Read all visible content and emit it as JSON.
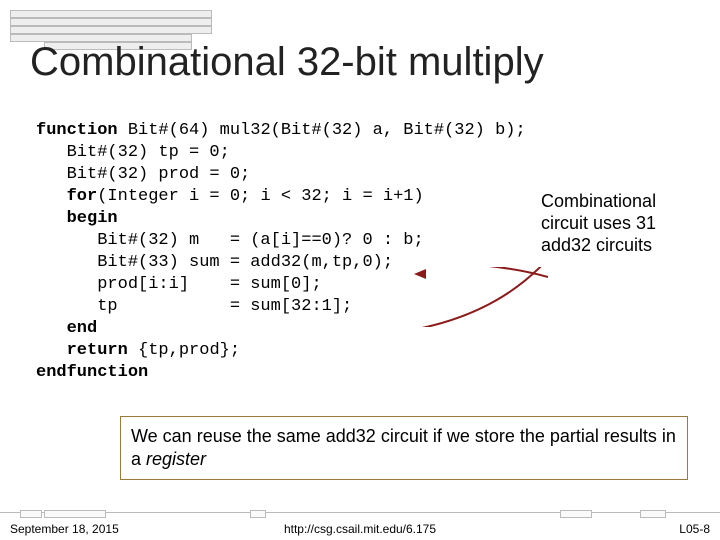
{
  "title": "Combinational 32-bit multiply",
  "code": {
    "l1a": "function",
    "l1b": " Bit#(64) mul32(Bit#(32) a, Bit#(32) b);",
    "l2": "   Bit#(32) tp = 0;",
    "l3": "   Bit#(32) prod = 0;",
    "l4a": "   ",
    "l4b": "for",
    "l4c": "(Integer i = 0; i < 32; i = i+1)",
    "l5": "   begin",
    "l6": "      Bit#(32) m   = (a[i]==0)? 0 : b;",
    "l7": "      Bit#(33) sum = add32(m,tp,0);",
    "l8": "      prod[i:i]    = sum[0];",
    "l9": "      tp           = sum[32:1];",
    "l10": "   end",
    "l11a": "   ",
    "l11b": "return",
    "l11c": " {tp,prod};",
    "l12": "endfunction"
  },
  "annotation": "Combinational circuit uses 31 add32 circuits",
  "callout_1": "We can reuse the same add32 circuit if we store the partial results in a ",
  "callout_2": "register",
  "footer": {
    "date": "September 18, 2015",
    "url": "http://csg.csail.mit.edu/6.175",
    "page": "L05-8"
  }
}
